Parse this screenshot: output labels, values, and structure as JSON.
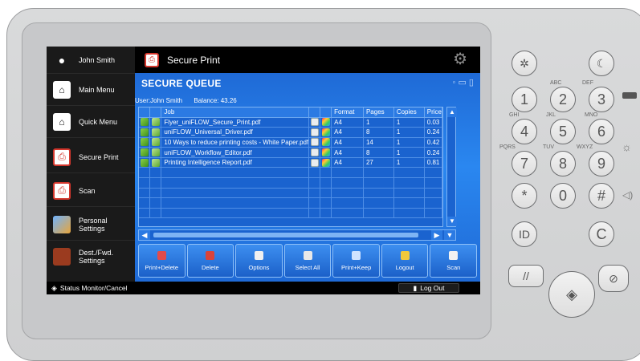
{
  "sidebar": {
    "items": [
      {
        "label": "John Smith",
        "icon": "user-icon",
        "color": "#ffffff"
      },
      {
        "label": "Main Menu",
        "icon": "home-icon",
        "color": "#ffffff"
      },
      {
        "label": "Quick Menu",
        "icon": "quick-menu-icon",
        "color": "#ffffff"
      },
      {
        "label": "Secure Print",
        "icon": "secure-print-icon",
        "color": "#d3362c"
      },
      {
        "label": "Scan",
        "icon": "scan-icon",
        "color": "#d3362c"
      },
      {
        "label": "Personal\nSettings",
        "icon": "personal-settings-icon",
        "color": "#e8a53a"
      },
      {
        "label": "Dest./Fwd.\nSettings",
        "icon": "dest-fwd-settings-icon",
        "color": "#9b3b1f"
      }
    ]
  },
  "topbar": {
    "title": "Secure Print",
    "icon": "secure-print-icon",
    "settings_icon": "gear-icon"
  },
  "queue": {
    "title": "SECURE QUEUE",
    "user_label": "User:John Smith",
    "balance_label": "Balance: 43.26",
    "columns": [
      "",
      "",
      "Job",
      "",
      "",
      "Format",
      "Pages",
      "Copies",
      "Price"
    ],
    "rows": [
      {
        "job": "Flyer_uniFLOW_Secure_Print.pdf",
        "format": "A4",
        "pages": "1",
        "copies": "1",
        "price": "0.03"
      },
      {
        "job": "uniFLOW_Universal_Driver.pdf",
        "format": "A4",
        "pages": "8",
        "copies": "1",
        "price": "0.24"
      },
      {
        "job": "10 Ways to reduce printing costs - White Paper.pdf",
        "format": "A4",
        "pages": "14",
        "copies": "1",
        "price": "0.42"
      },
      {
        "job": "uniFLOW_Workflow_Editor.pdf",
        "format": "A4",
        "pages": "8",
        "copies": "1",
        "price": "0.24"
      },
      {
        "job": "Printing Intelligence Report.pdf",
        "format": "A4",
        "pages": "27",
        "copies": "1",
        "price": "0.81"
      }
    ]
  },
  "actions": [
    {
      "label": "Print+Delete",
      "color": "#e24b4b"
    },
    {
      "label": "Delete",
      "color": "#d9433a"
    },
    {
      "label": "Options",
      "color": "#f0f0f0"
    },
    {
      "label": "Select All",
      "color": "#e8e8e8"
    },
    {
      "label": "Print+Keep",
      "color": "#d0e3ff"
    },
    {
      "label": "Logout",
      "color": "#f1c93b"
    },
    {
      "label": "Scan",
      "color": "#f2f2f2"
    }
  ],
  "statusbar": {
    "status_label": "Status Monitor/Cancel",
    "logout_label": "Log Out"
  },
  "keypad": {
    "digits": [
      "1",
      "2",
      "3",
      "4",
      "5",
      "6",
      "7",
      "8",
      "9",
      "*",
      "0",
      "#"
    ],
    "letters": [
      "ABC",
      "DEF",
      "GHI",
      "JKL",
      "MNO",
      "PQRS",
      "TUV",
      "WXYZ"
    ],
    "extra_keys": [
      "ID",
      "C"
    ]
  }
}
